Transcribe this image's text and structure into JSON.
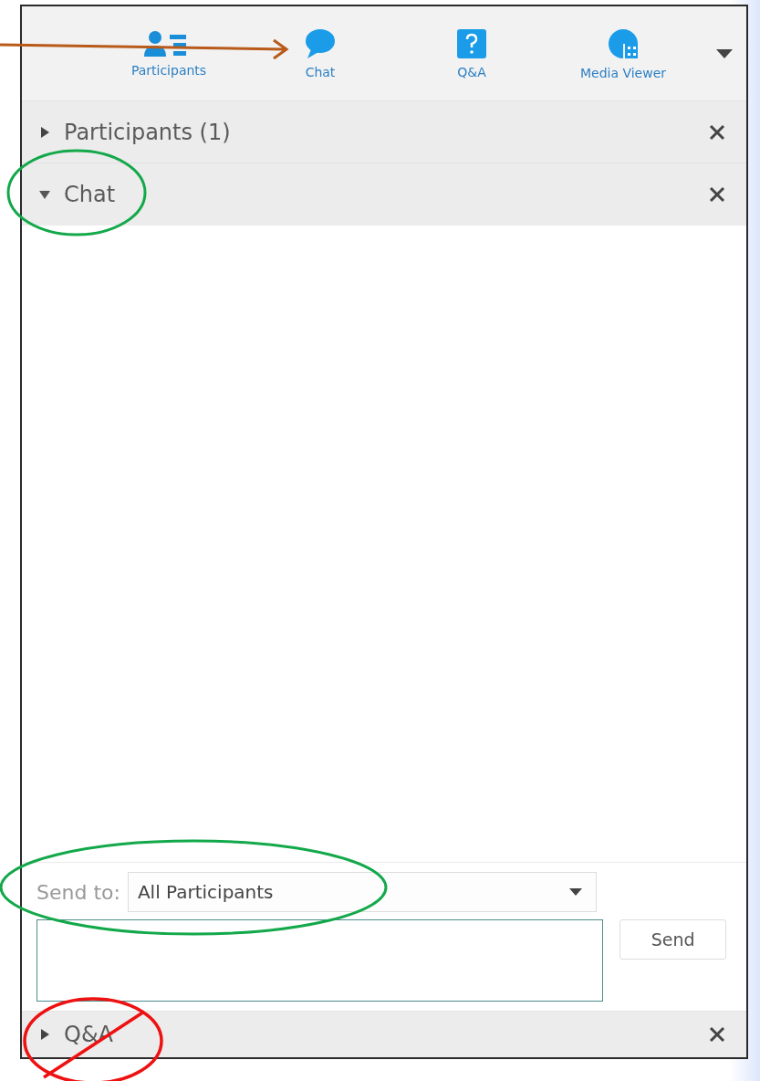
{
  "toolbar": {
    "items": [
      {
        "label": "Participants"
      },
      {
        "label": "Chat"
      },
      {
        "label": "Q&A"
      },
      {
        "label": "Media Viewer"
      }
    ]
  },
  "sections": [
    {
      "title": "Participants (1)",
      "expanded": false,
      "kind": "list"
    },
    {
      "title": "Chat",
      "expanded": true,
      "kind": "chat"
    },
    {
      "title": "Q&A",
      "expanded": false,
      "kind": "qa"
    }
  ],
  "chat": {
    "send_to_label": "Send to:",
    "recipient": "All Participants",
    "send_button": "Send"
  }
}
